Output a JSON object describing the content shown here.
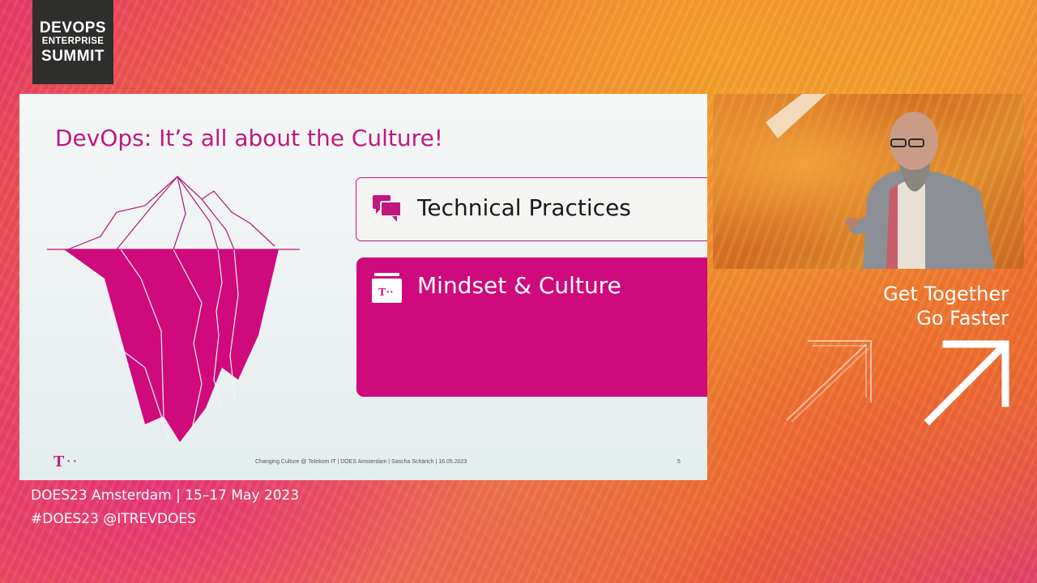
{
  "brand": {
    "logo_line1": "DEVOPS",
    "logo_line2": "ENTERPRISE",
    "logo_line3": "SUMMIT"
  },
  "slide": {
    "title": "DevOps: It’s all about the Culture!",
    "boxes": [
      {
        "label": "Technical Practices",
        "icon": "chat-bubbles-icon"
      },
      {
        "label": "Mindset & Culture",
        "icon": "telekom-card-icon",
        "icon_text": "T··"
      }
    ],
    "footer": "Changing Culture @ Telekom IT | DOES Amsterdam | Sascha Schärich | 16.05.2023",
    "page_number": "5",
    "logo_mark": "T",
    "logo_dots": "··"
  },
  "tagline": {
    "line1": "Get Together",
    "line2": "Go Faster"
  },
  "event": {
    "line1": "DOES23 Amsterdam  |  15–17 May 2023",
    "line2": "#DOES23  @ITREVDOES"
  },
  "colors": {
    "magenta": "#cf0a7d",
    "title_magenta": "#c0187f",
    "logo_bg": "#2e2e2c"
  }
}
